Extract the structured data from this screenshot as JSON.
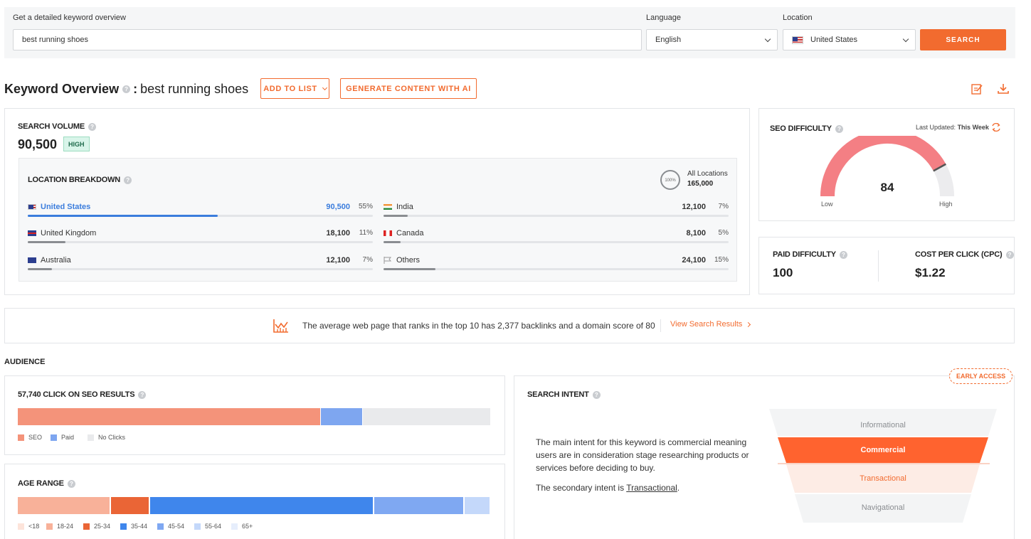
{
  "search": {
    "keyword_label": "Get a detailed keyword overview",
    "keyword_value": "best running shoes",
    "language_label": "Language",
    "language_value": "English",
    "location_label": "Location",
    "location_value": "United States",
    "button": "SEARCH"
  },
  "header": {
    "title": "Keyword Overview",
    "separator": ":",
    "keyword": "best running shoes",
    "add_to_list": "ADD TO LIST",
    "generate_ai": "GENERATE CONTENT WITH AI"
  },
  "volume": {
    "label": "SEARCH VOLUME",
    "value": "90,500",
    "badge": "HIGH",
    "breakdown_label": "LOCATION BREAKDOWN",
    "all_locations_label": "All Locations",
    "all_locations_value": "165,000",
    "all_pct": "100%",
    "locations": [
      {
        "name": "United States",
        "value": "90,500",
        "pct": "55%",
        "fill": 0.55,
        "active": true
      },
      {
        "name": "India",
        "value": "12,100",
        "pct": "7%",
        "fill": 0.07
      },
      {
        "name": "United Kingdom",
        "value": "18,100",
        "pct": "11%",
        "fill": 0.11
      },
      {
        "name": "Canada",
        "value": "8,100",
        "pct": "5%",
        "fill": 0.05
      },
      {
        "name": "Australia",
        "value": "12,100",
        "pct": "7%",
        "fill": 0.07
      },
      {
        "name": "Others",
        "value": "24,100",
        "pct": "15%",
        "fill": 0.15
      }
    ]
  },
  "seo": {
    "label": "SEO DIFFICULTY",
    "updated_prefix": "Last Updated:",
    "updated_value": "This Week",
    "value": "84",
    "low": "Low",
    "high": "High",
    "gauge_fraction": 0.84
  },
  "paid": {
    "label": "PAID DIFFICULTY",
    "value": "100",
    "cpc_label": "COST PER CLICK (CPC)",
    "cpc_value": "$1.22"
  },
  "banner": {
    "text": "The average web page that ranks in the top 10 has 2,377 backlinks and a domain score of 80",
    "link": "View Search Results"
  },
  "audience": {
    "label": "AUDIENCE",
    "clicks_label": "57,740 CLICK ON SEO RESULTS",
    "clicks_segments": [
      {
        "name": "SEO",
        "fraction": 0.64,
        "color": "#f4937a"
      },
      {
        "name": "Paid",
        "fraction": 0.09,
        "color": "#7ea6f0"
      },
      {
        "name": "No Clicks",
        "fraction": 0.27,
        "color": "#e9eaec"
      }
    ],
    "age_label": "AGE RANGE",
    "age_segments": [
      {
        "name": "<18",
        "fraction": 0.0,
        "color": "#fde4da"
      },
      {
        "name": "18-24",
        "fraction": 0.197,
        "color": "#f8b199"
      },
      {
        "name": "25-34",
        "fraction": 0.083,
        "color": "#ea6536"
      },
      {
        "name": "35-44",
        "fraction": 0.474,
        "color": "#3f86ec"
      },
      {
        "name": "45-54",
        "fraction": 0.191,
        "color": "#7fa8f2"
      },
      {
        "name": "55-64",
        "fraction": 0.055,
        "color": "#c4d8fa"
      },
      {
        "name": "65+",
        "fraction": 0.0,
        "color": "#e6eefc"
      }
    ]
  },
  "intent": {
    "label": "SEARCH INTENT",
    "badge": "EARLY ACCESS",
    "main_text": "The main intent for this keyword is commercial meaning users are in consideration stage researching products or services before deciding to buy.",
    "secondary_prefix": "The secondary intent is",
    "secondary_value": "Transactional",
    "secondary_suffix": ".",
    "funnel": [
      "Informational",
      "Commercial",
      "Transactional",
      "Navigational"
    ]
  },
  "colors": {
    "accent": "#f26b2f",
    "link_blue": "#3b7ddd",
    "gauge": "#f47f84"
  }
}
